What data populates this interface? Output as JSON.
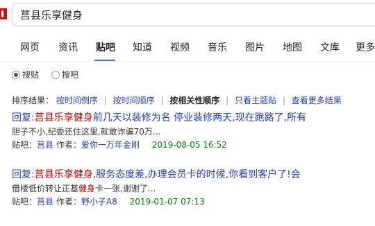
{
  "search": {
    "query": "莒县乐享健身"
  },
  "tabs": [
    {
      "label": "网页"
    },
    {
      "label": "资讯"
    },
    {
      "label": "贴吧"
    },
    {
      "label": "知道"
    },
    {
      "label": "视频"
    },
    {
      "label": "音乐"
    },
    {
      "label": "图片"
    },
    {
      "label": "地图"
    },
    {
      "label": "文库"
    },
    {
      "label": "更多"
    }
  ],
  "active_tab": "贴吧",
  "radios": [
    {
      "label": "搜贴",
      "selected": true
    },
    {
      "label": "搜吧",
      "selected": false
    }
  ],
  "sort": {
    "prefix": "排序结果：",
    "by_time_desc": "按时间倒序",
    "by_time_asc": "按时间顺序",
    "by_relevance": "按相关性顺序",
    "only_topic": "只看主题贴",
    "more_results": "查看更多结果"
  },
  "results": [
    {
      "title_prefix": "回复:",
      "title_highlight": "莒县乐享健身",
      "title_rest": "前几天以装修为名 停业装修两天,现在跑路了,所有",
      "snippet_before": "胆子不小,纪委还住这里,就敢诈骗70万...",
      "snippet_highlight": "",
      "snippet_after": "",
      "bar_label": "贴吧：",
      "bar_name": "莒县",
      "author_label": "作者：",
      "author": "爱你一万年金刚",
      "date": "2019-08-05 16:52"
    },
    {
      "title_prefix": "回复:",
      "title_highlight": "莒县乐享健身",
      "title_rest": ",服务态度差,办理会员卡的时候,你看到客户了!会",
      "snippet_before": "借楼低价转让正基",
      "snippet_highlight": "健身",
      "snippet_after": "卡一张,谢谢了...",
      "bar_label": "贴吧：",
      "bar_name": "莒县",
      "author_label": "作者：",
      "author": "野小子A8",
      "date": "2019-01-07 07:13"
    }
  ],
  "colors": {
    "link": "#2440b3",
    "highlight": "#cc0000",
    "date": "#008000",
    "tab_indicator": "#4e6ef2",
    "logo": "#e10601"
  }
}
